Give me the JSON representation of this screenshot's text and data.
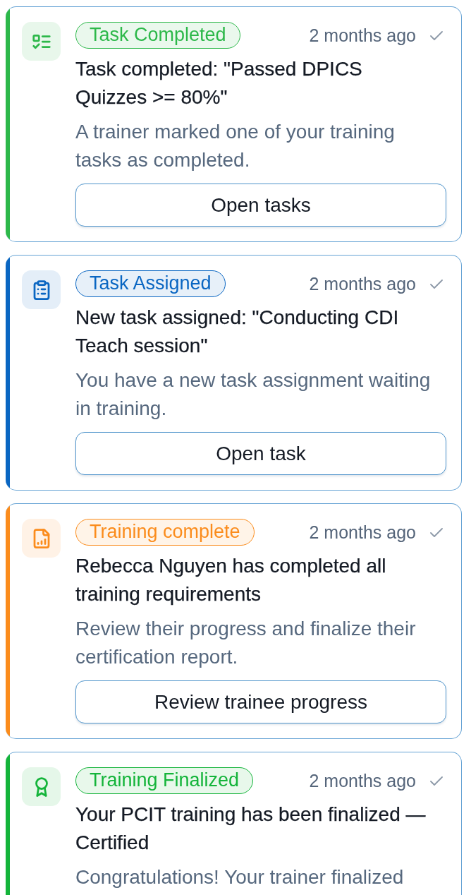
{
  "notifications": [
    {
      "kind": "completed",
      "color": "#2db84a",
      "badge": "Task Completed",
      "time": "2 months ago",
      "read": true,
      "title": "Task completed: \"Passed DPICS Quizzes >= 80%\"",
      "description": "A trainer marked one of your training tasks as completed.",
      "action": "Open tasks"
    },
    {
      "kind": "assigned",
      "color": "#0a66c2",
      "badge": "Task Assigned",
      "time": "2 months ago",
      "read": true,
      "title": "New task assigned: \"Conducting CDI Teach session\"",
      "description": "You have a new task assignment waiting in training.",
      "action": "Open task"
    },
    {
      "kind": "report",
      "color": "#fb8c1c",
      "badge": "Training complete",
      "time": "2 months ago",
      "read": true,
      "title": "Rebecca Nguyen has completed all training requirements",
      "description": "Review their progress and finalize their certification report.",
      "action": "Review trainee progress"
    },
    {
      "kind": "certified",
      "color": "#14b43a",
      "badge": "Training Finalized",
      "time": "2 months ago",
      "read": true,
      "title": "Your PCIT training has been finalized — Certified",
      "description": "Congratulations! Your trainer finalized"
    }
  ]
}
